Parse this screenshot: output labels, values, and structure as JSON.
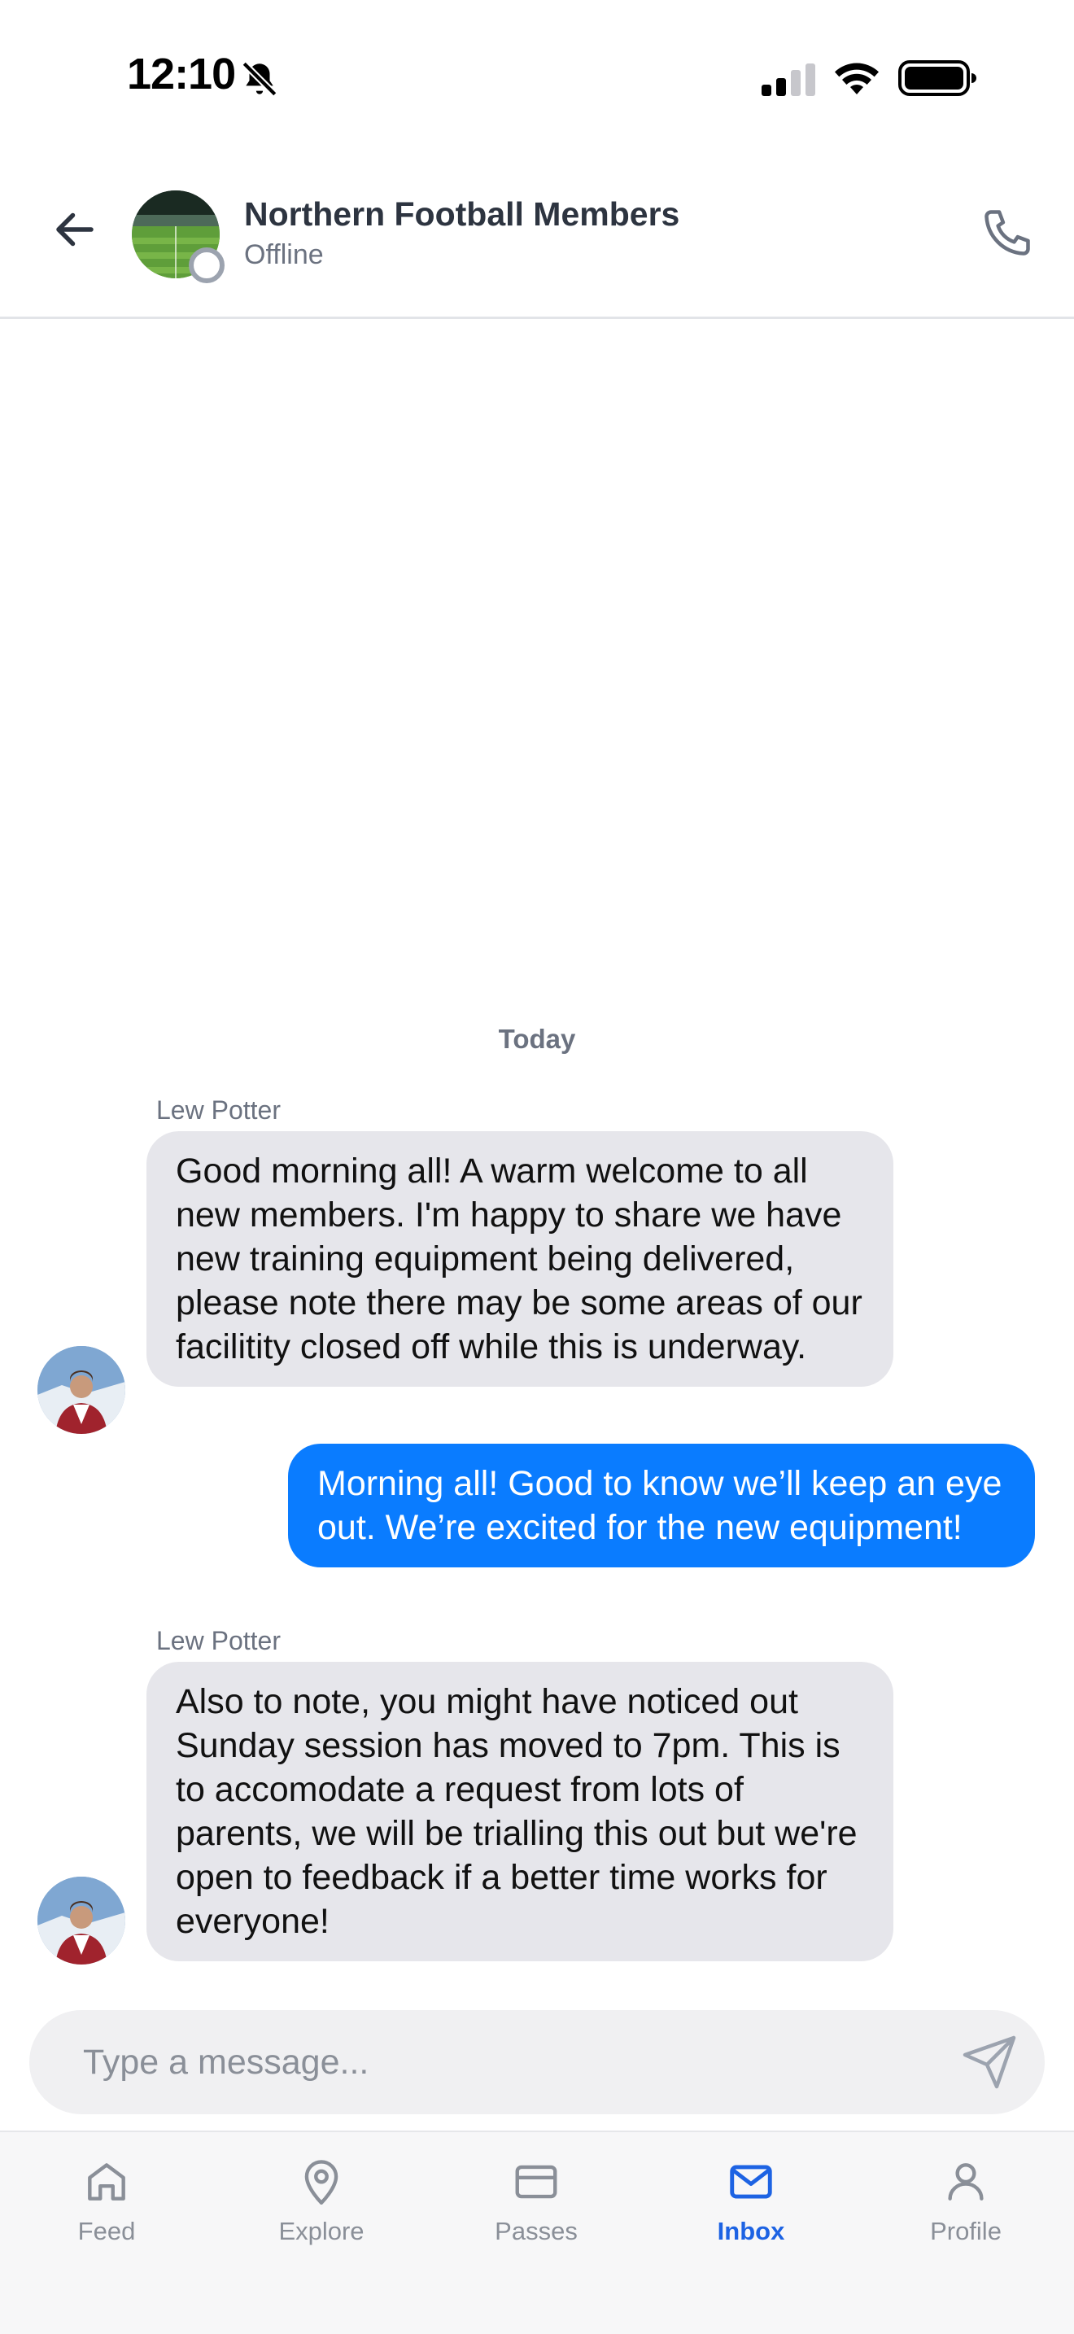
{
  "status_bar": {
    "time": "12:10"
  },
  "header": {
    "title": "Northern Football Members",
    "subtitle": "Offline"
  },
  "conversation": {
    "date_label": "Today",
    "messages": [
      {
        "sender": "Lew Potter",
        "direction": "incoming",
        "text": "Good morning all! A warm welcome to all new members. I'm happy to share we have new training equipment being delivered, please note there may be some areas of our facilitity closed off while this is underway."
      },
      {
        "sender": "",
        "direction": "outgoing",
        "text": "Morning all! Good to know we’ll keep an eye out. We’re excited for the new equipment!"
      },
      {
        "sender": "Lew Potter",
        "direction": "incoming",
        "text": "Also to note, you might have noticed out Sunday session has moved to 7pm. This is to accomodate a request from lots of parents, we will be trialling this out but we're open to feedback if a better time works for everyone!"
      }
    ]
  },
  "composer": {
    "placeholder": "Type a message...",
    "value": ""
  },
  "tabs": [
    {
      "label": "Feed",
      "icon": "home-icon",
      "active": false
    },
    {
      "label": "Explore",
      "icon": "map-pin-icon",
      "active": false
    },
    {
      "label": "Passes",
      "icon": "card-icon",
      "active": false
    },
    {
      "label": "Inbox",
      "icon": "mail-icon",
      "active": true
    },
    {
      "label": "Profile",
      "icon": "user-icon",
      "active": false
    }
  ],
  "colors": {
    "accent": "#1d63e3",
    "outgoing_bubble": "#0a7cff",
    "incoming_bubble": "#e6e6eb",
    "inactive": "#8a8f98"
  }
}
